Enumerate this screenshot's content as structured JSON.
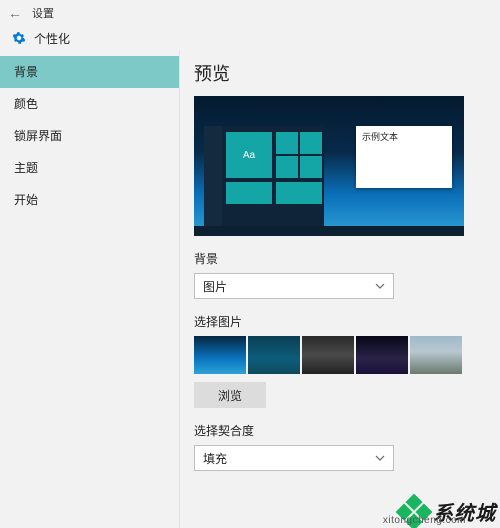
{
  "topbar": {
    "app_title": "设置"
  },
  "category": {
    "title": "个性化"
  },
  "sidebar": {
    "items": [
      {
        "label": "背景",
        "selected": true
      },
      {
        "label": "颜色",
        "selected": false
      },
      {
        "label": "锁屏界面",
        "selected": false
      },
      {
        "label": "主题",
        "selected": false
      },
      {
        "label": "开始",
        "selected": false
      }
    ]
  },
  "main": {
    "preview_heading": "预览",
    "preview_sample_text": "示例文本",
    "preview_tile_text": "Aa",
    "background_label": "背景",
    "background_value": "图片",
    "choose_picture_label": "选择图片",
    "browse_label": "浏览",
    "fit_label": "选择契合度",
    "fit_value": "填充"
  },
  "watermark": {
    "brand": "系统城",
    "url": "xitongcheng.com"
  }
}
